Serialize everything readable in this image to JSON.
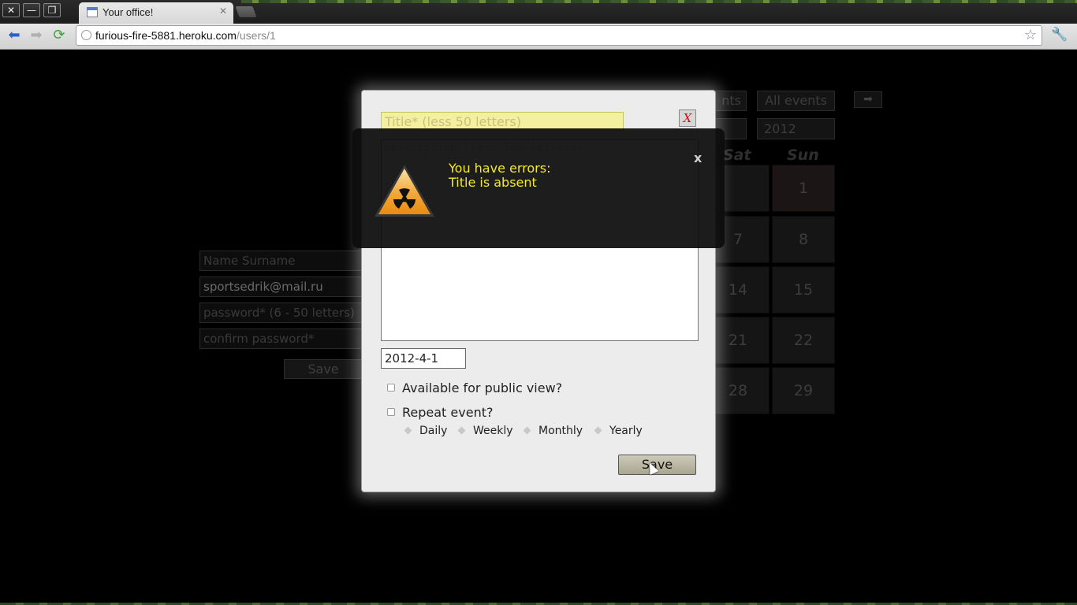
{
  "browser": {
    "tab_title": "Your office!",
    "url_host": "furious-fire-5881.heroku.com",
    "url_path": "/users/1",
    "window_buttons": [
      "✕",
      "—",
      "❐"
    ]
  },
  "background_page": {
    "profile_form": {
      "name_placeholder": "Name Surname",
      "email_value": "sportsedrik@mail.ru",
      "password_placeholder": "password* (6 - 50 letters)",
      "confirm_placeholder": "confirm password*",
      "save_label": "Save"
    },
    "calendar": {
      "events_button": "nts",
      "all_events_button": "All events",
      "year_value": "2012",
      "day_headers": [
        "Sat",
        "Sun"
      ],
      "rows": [
        [
          "",
          "1"
        ],
        [
          "7",
          "8"
        ],
        [
          "14",
          "15"
        ],
        [
          "21",
          "22"
        ],
        [
          "28",
          "29"
        ]
      ]
    }
  },
  "event_modal": {
    "title_placeholder": "Title* (less 50 letters)",
    "close_label": "X",
    "description_placeholder": "Description (less 500 letters)",
    "date_value": "2012-4-1",
    "public_label": "Available for public view?",
    "repeat_label": "Repeat event?",
    "repeat_options": [
      "Daily",
      "Weekly",
      "Monthly",
      "Yearly"
    ],
    "save_label": "Save"
  },
  "error_notice": {
    "title": "You have errors:",
    "message": "Title is absent",
    "close_label": "x",
    "icon": "radiation-warning-icon"
  }
}
